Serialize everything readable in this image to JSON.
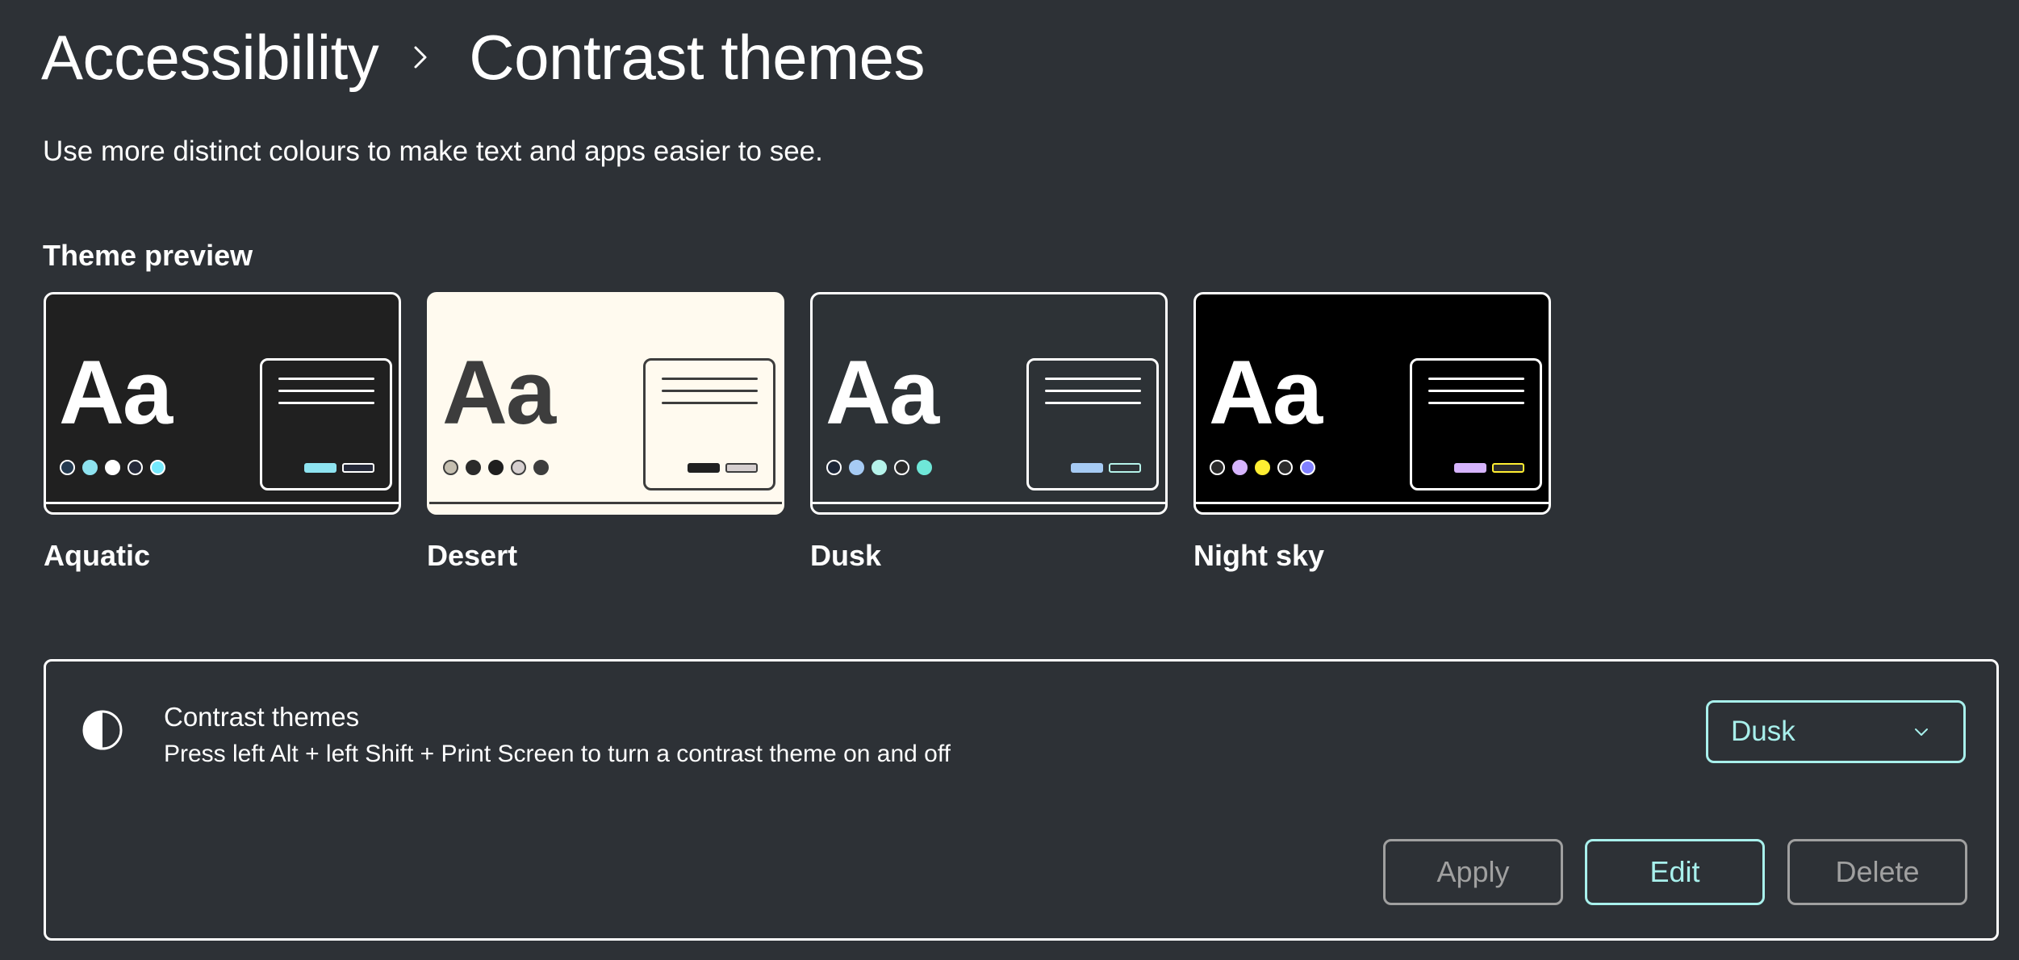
{
  "header": {
    "breadcrumb_parent": "Accessibility",
    "breadcrumb_separator_icon": "chevron-right-icon",
    "page_title": "Contrast themes",
    "description": "Use more distinct colours to make text and apps easier to see."
  },
  "theme_preview": {
    "label": "Theme preview",
    "sample_text": "Aa",
    "themes": [
      {
        "name": "Aquatic",
        "background": "#202020",
        "foreground": "#ffffff",
        "outline": "#ffffff",
        "dots": [
          "#243a50",
          "#8ee3f0",
          "#ffffff",
          "#262a3a",
          "#75e9fc"
        ],
        "dot_borders": [
          "#ffffff",
          "#8ee3f0",
          "#ffffff",
          "#ffffff",
          "#ffffff"
        ],
        "primary_button": "#8ee3f0",
        "secondary_button_fill": "#262a3a",
        "secondary_button_border": "#ffffff"
      },
      {
        "name": "Desert",
        "background": "#fffaef",
        "foreground": "#3d3d3d",
        "outline": "#fffaef",
        "dots": [
          "#c5bfb0",
          "#2b2b2b",
          "#1f1f1f",
          "#d6cfcf",
          "#3d3d3d"
        ],
        "dot_borders": [
          "#3d3d3d",
          "#2b2b2b",
          "#1f1f1f",
          "#3d3d3d",
          "#3d3d3d"
        ],
        "primary_button": "#202020",
        "secondary_button_fill": "#d6cfcf",
        "secondary_button_border": "#3d3d3d"
      },
      {
        "name": "Dusk",
        "background": "#2d3236",
        "foreground": "#ffffff",
        "outline": "#ffffff",
        "dots": [
          "#1c2638",
          "#a6cbf4",
          "#b5f3ea",
          "#2b2b2b",
          "#6fe7d8"
        ],
        "dot_borders": [
          "#ffffff",
          "#a6cbf4",
          "#b5f3ea",
          "#ffffff",
          "#6fe7d8"
        ],
        "primary_button": "#a6cbf4",
        "secondary_button_fill": "#2d3236",
        "secondary_button_border": "#b5f3ea"
      },
      {
        "name": "Night sky",
        "background": "#000000",
        "foreground": "#ffffff",
        "outline": "#ffffff",
        "dots": [
          "#2b2b2b",
          "#d6b4fd",
          "#ffee32",
          "#2b2b2b",
          "#8080ff"
        ],
        "dot_borders": [
          "#ffffff",
          "#d6b4fd",
          "#ffee32",
          "#ffffff",
          "#ffffff"
        ],
        "primary_button": "#d6b4fd",
        "secondary_button_fill": "#2b2b2b",
        "secondary_button_border": "#ffee32"
      }
    ]
  },
  "contrast_setting": {
    "icon": "contrast-icon",
    "title": "Contrast themes",
    "subtitle": "Press left Alt + left Shift + Print Screen to turn a contrast theme on and off",
    "selected_theme": "Dusk",
    "dropdown_icon": "chevron-down-icon",
    "buttons": {
      "apply": "Apply",
      "edit": "Edit",
      "delete": "Delete"
    }
  },
  "colors": {
    "background": "#2d3136",
    "text": "#ffffff",
    "accent": "#a8f0ec",
    "disabled": "#a0a0a0"
  }
}
